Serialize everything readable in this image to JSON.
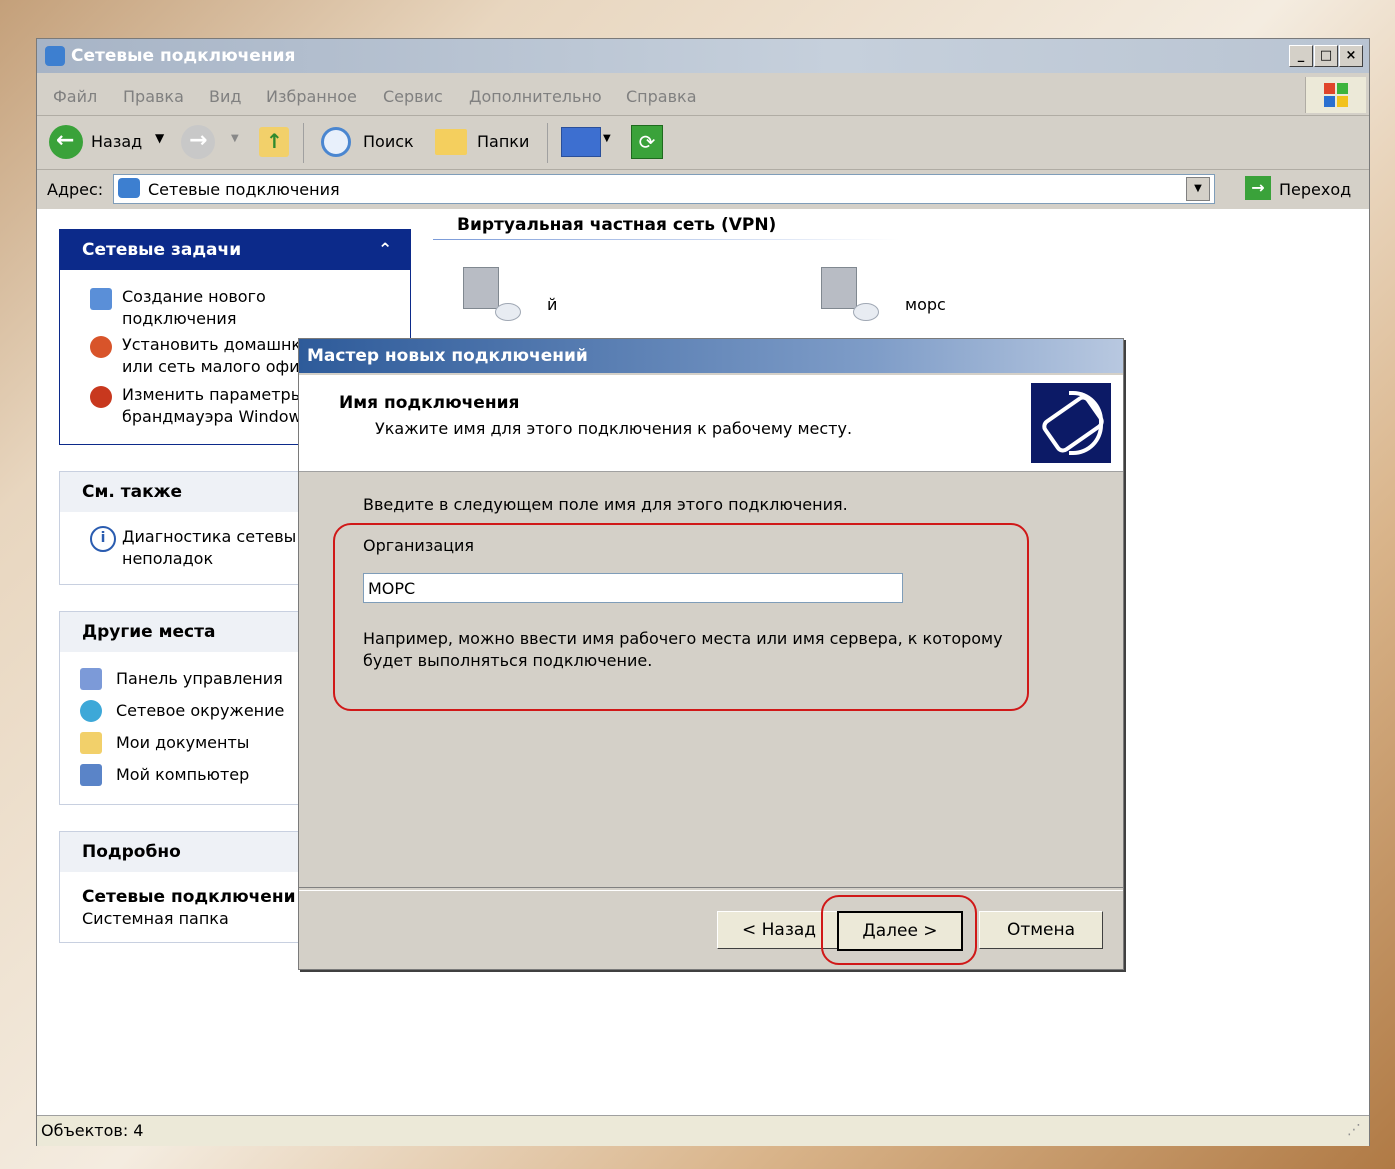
{
  "window": {
    "title": "Сетевые подключения",
    "menu": [
      "Файл",
      "Правка",
      "Вид",
      "Избранное",
      "Сервис",
      "Дополнительно",
      "Справка"
    ],
    "toolbar": {
      "back_label": "Назад",
      "search_label": "Поиск",
      "folders_label": "Папки"
    },
    "address": {
      "label": "Адрес:",
      "value": "Сетевые подключения",
      "go_label": "Переход"
    },
    "status": "Объектов: 4"
  },
  "sidebar": {
    "network_tasks": {
      "title": "Сетевые задачи",
      "items": [
        {
          "line1": "Создание нового",
          "line2": "подключения"
        },
        {
          "line1": "Установить домашнк",
          "line2": "или сеть малого офи"
        },
        {
          "line1": "Изменить параметры",
          "line2": "брандмауэра Window"
        }
      ]
    },
    "see_also": {
      "title": "См. также",
      "items": [
        {
          "line1": "Диагностика сетевы",
          "line2": "неполадок"
        }
      ]
    },
    "other_places": {
      "title": "Другие места",
      "items": [
        "Панель управления",
        "Сетевое окружение",
        "Мои документы",
        "Мой компьютер"
      ]
    },
    "details": {
      "title": "Подробно",
      "name": "Сетевые подключени",
      "type": "Системная папка"
    }
  },
  "vpn": {
    "group_title": "Виртуальная частная сеть (VPN)",
    "connections": [
      "й",
      "морс"
    ]
  },
  "dialog": {
    "title": "Мастер новых подключений",
    "header_title": "Имя подключения",
    "header_subtitle": "Укажите имя для этого подключения к рабочему месту.",
    "instruction": "Введите в следующем поле имя для этого подключения.",
    "field_label": "Организация",
    "field_value": "МОРС",
    "hint_line1": "Например, можно ввести имя рабочего места или имя сервера, к которому",
    "hint_line2": "будет выполняться подключение.",
    "back_button": "< Назад",
    "next_button": "Далее >",
    "cancel_button": "Отмена"
  },
  "colors": {
    "panel_header_blue": "#0c2a8a",
    "highlight_red": "#d01818",
    "dialog_title_blue": "#2e5b9a"
  }
}
